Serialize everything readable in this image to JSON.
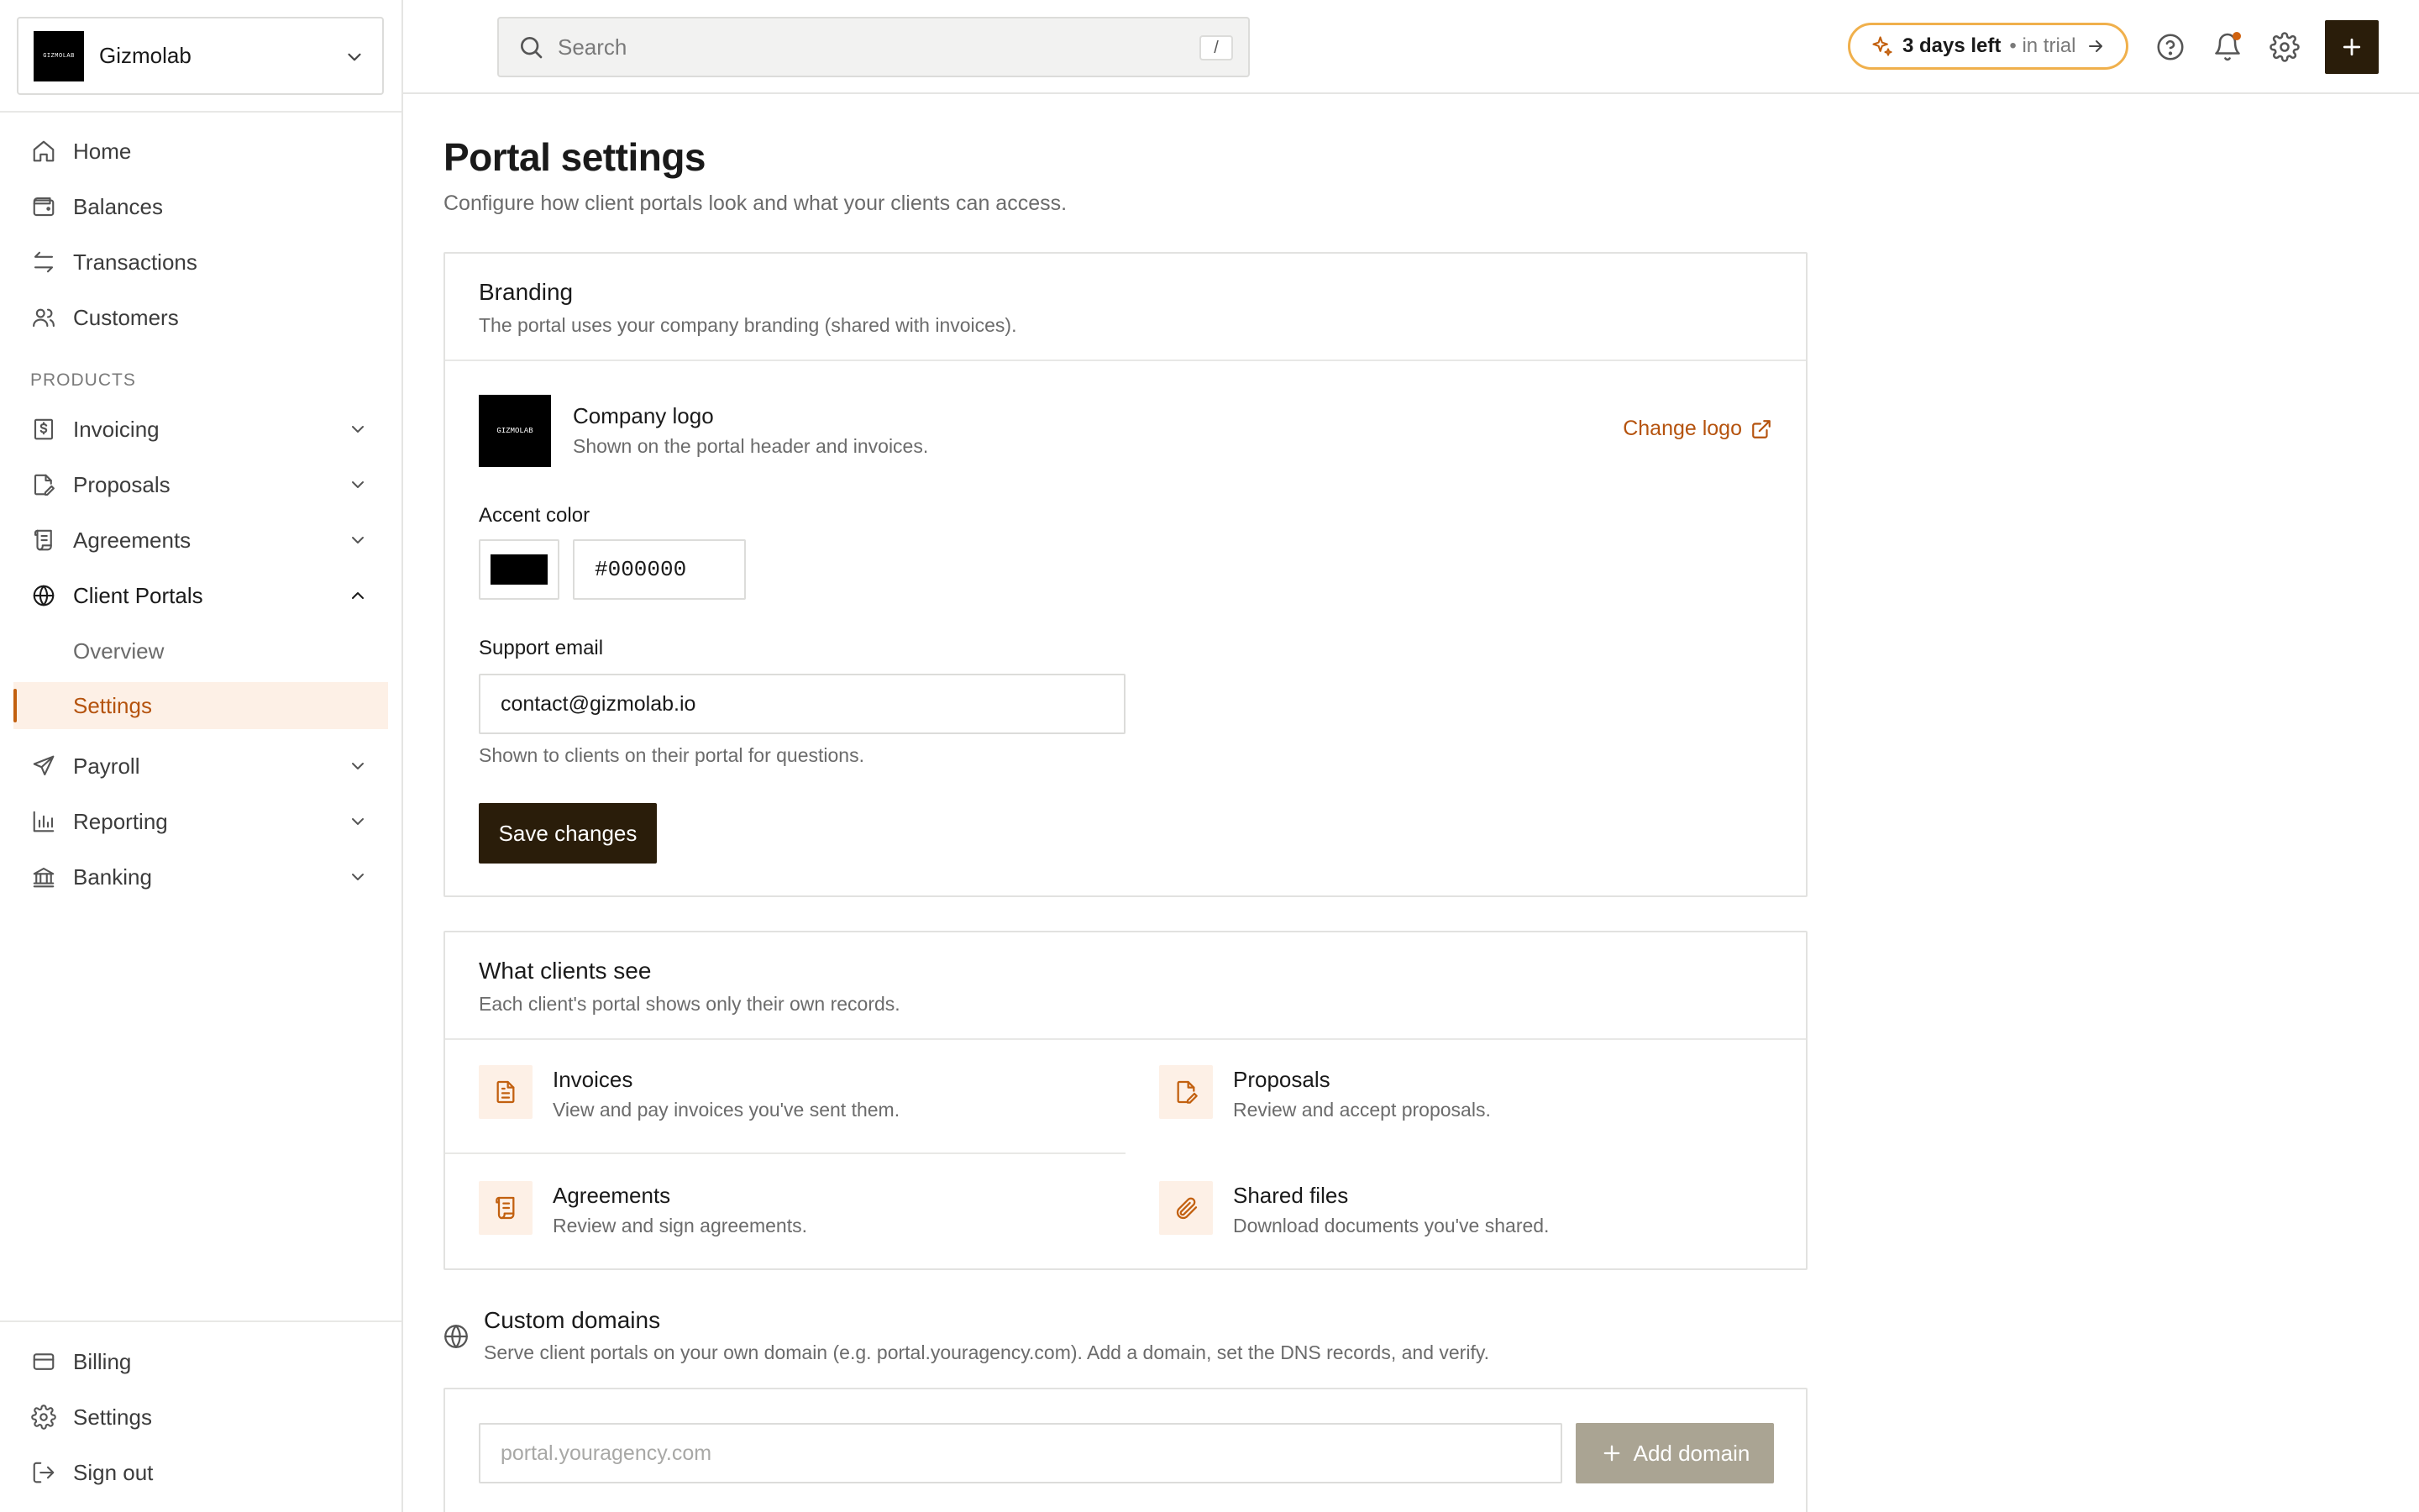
{
  "org": {
    "name": "Gizmolab",
    "logo_text": "GIZMOLAB"
  },
  "sidebar": {
    "main_items": [
      {
        "label": "Home",
        "icon": "home-icon"
      },
      {
        "label": "Balances",
        "icon": "wallet-icon"
      },
      {
        "label": "Transactions",
        "icon": "arrows-exchange-icon"
      },
      {
        "label": "Customers",
        "icon": "users-icon"
      }
    ],
    "section_label": "PRODUCTS",
    "product_items": [
      {
        "label": "Invoicing",
        "icon": "dollar-doc-icon"
      },
      {
        "label": "Proposals",
        "icon": "doc-edit-icon"
      },
      {
        "label": "Agreements",
        "icon": "scroll-icon"
      },
      {
        "label": "Client Portals",
        "icon": "globe-icon"
      },
      {
        "label": "Payroll",
        "icon": "send-icon"
      },
      {
        "label": "Reporting",
        "icon": "bar-chart-icon"
      },
      {
        "label": "Banking",
        "icon": "bank-icon"
      }
    ],
    "portal_subitems": [
      "Overview",
      "Settings"
    ],
    "bottom_items": [
      {
        "label": "Billing",
        "icon": "credit-card-icon"
      },
      {
        "label": "Settings",
        "icon": "gear-icon"
      },
      {
        "label": "Sign out",
        "icon": "sign-out-icon"
      }
    ]
  },
  "topbar": {
    "search_placeholder": "Search",
    "search_shortcut": "/",
    "trial_bold": "3 days left",
    "trial_rest": "• in trial"
  },
  "page": {
    "title": "Portal settings",
    "subtitle": "Configure how client portals look and what your clients can access."
  },
  "branding": {
    "title": "Branding",
    "desc": "The portal uses your company branding (shared with invoices).",
    "logo_label": "Company logo",
    "logo_desc": "Shown on the portal header and invoices.",
    "change_logo": "Change logo",
    "accent_label": "Accent color",
    "accent_value": "#000000",
    "support_label": "Support email",
    "support_value": "contact@gizmolab.io",
    "support_help": "Shown to clients on their portal for questions.",
    "save_label": "Save changes"
  },
  "clients_see": {
    "title": "What clients see",
    "desc": "Each client's portal shows only their own records.",
    "features": [
      {
        "title": "Invoices",
        "desc": "View and pay invoices you've sent them.",
        "icon": "invoice-doc-icon"
      },
      {
        "title": "Proposals",
        "desc": "Review and accept proposals.",
        "icon": "proposal-edit-icon"
      },
      {
        "title": "Agreements",
        "desc": "Review and sign agreements.",
        "icon": "agreement-scroll-icon"
      },
      {
        "title": "Shared files",
        "desc": "Download documents you've shared.",
        "icon": "paperclip-icon"
      }
    ]
  },
  "domains": {
    "title": "Custom domains",
    "desc": "Serve client portals on your own domain (e.g. portal.youragency.com). Add a domain, set the DNS records, and verify.",
    "input_placeholder": "portal.youragency.com",
    "add_label": "Add domain"
  },
  "colors": {
    "accent_brand": "#2a1d0a",
    "highlight_orange": "#c2600f",
    "trial_border": "#f0b04c",
    "active_bg": "#fdf0e6"
  }
}
